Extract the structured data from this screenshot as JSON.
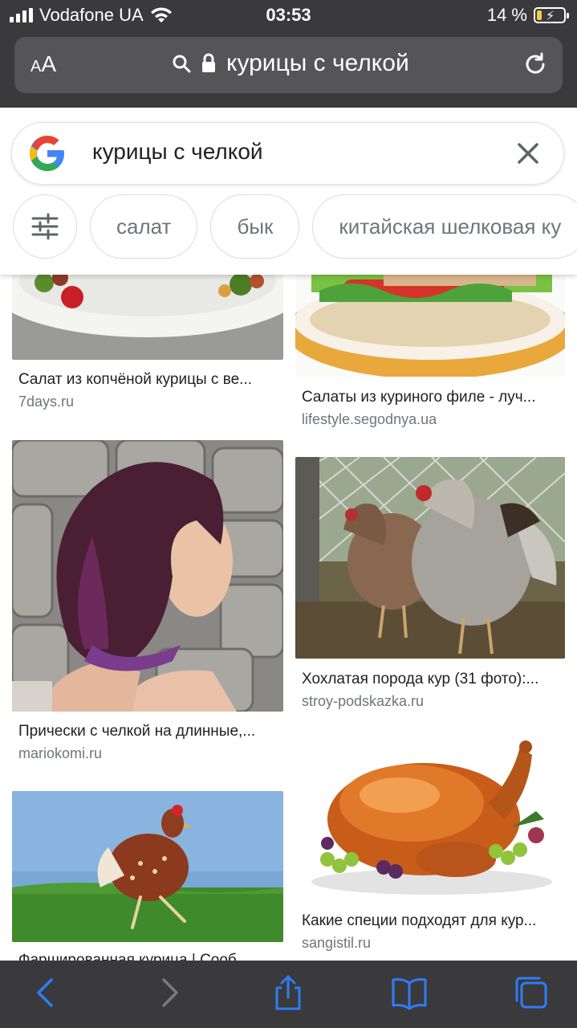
{
  "status_bar": {
    "carrier": "Vodafone UA",
    "time": "03:53",
    "battery": "14 %"
  },
  "safari": {
    "text_size_label": "AA",
    "url": "курицы с челкой",
    "icons": [
      "search-icon",
      "lock-icon",
      "reload-icon"
    ]
  },
  "google": {
    "query": "курицы с челкой",
    "chips": [
      "салат",
      "бык",
      "китайская шелковая ку"
    ]
  },
  "results": [
    {
      "title": "Салат из копчёной курицы с ве...",
      "site": "7days.ru"
    },
    {
      "title": "Салаты из куриного филе - луч...",
      "site": "lifestyle.segodnya.ua"
    },
    {
      "title": "Прически с челкой на длинные,...",
      "site": "mariokomi.ru"
    },
    {
      "title": "Хохлатая порода кур (31 фото):...",
      "site": "stroy-podskazka.ru"
    },
    {
      "title": "Какие специи подходят для кур...",
      "site": "sangistil.ru"
    },
    {
      "title": "Фаршированная курица | Сооб...",
      "site": ""
    }
  ],
  "toolbar": {
    "icons": [
      "back-icon",
      "forward-icon",
      "share-icon",
      "bookmarks-icon",
      "tabs-icon"
    ]
  },
  "colors": {
    "chrome": "#3a3a3c",
    "url_field": "#555558",
    "ios_blue": "#2f7cf6"
  }
}
